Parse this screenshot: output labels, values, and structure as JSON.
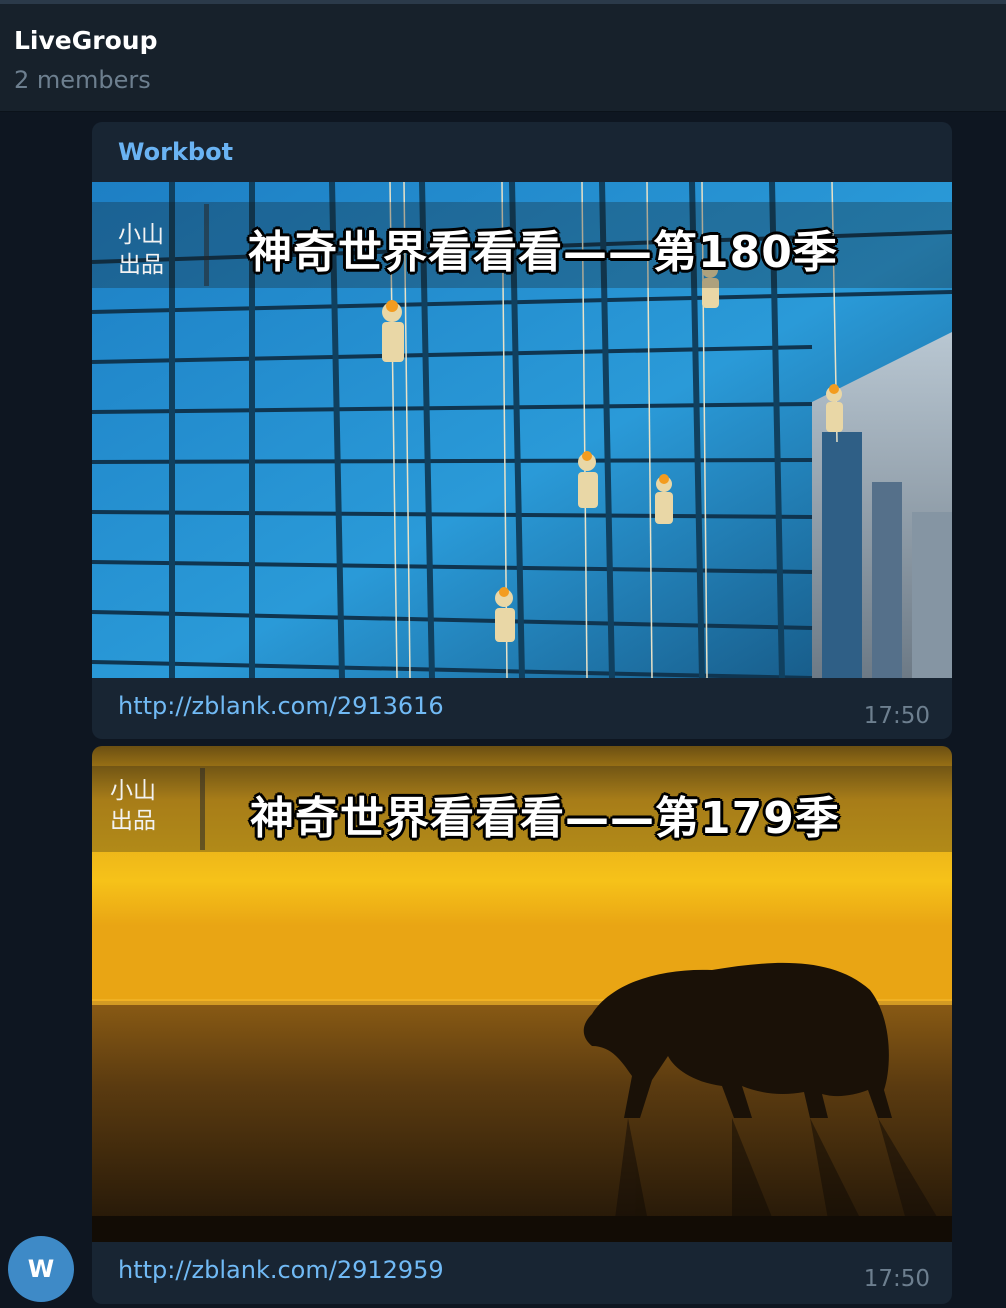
{
  "chat": {
    "title": "LiveGroup",
    "subtitle": "2 members"
  },
  "messages": [
    {
      "sender": "Workbot",
      "photo": {
        "logo_line1": "小山",
        "logo_line2": "出品",
        "caption": "神奇世界看看看——第180季"
      },
      "link": "http://zblank.com/2913616",
      "time": "17:50"
    },
    {
      "photo": {
        "logo_line1": "小山",
        "logo_line2": "出品",
        "caption": "神奇世界看看看——第179季"
      },
      "link": "http://zblank.com/2912959",
      "time": "17:50"
    }
  ],
  "avatar": {
    "initial": "W",
    "color": "#3e8ac7"
  }
}
